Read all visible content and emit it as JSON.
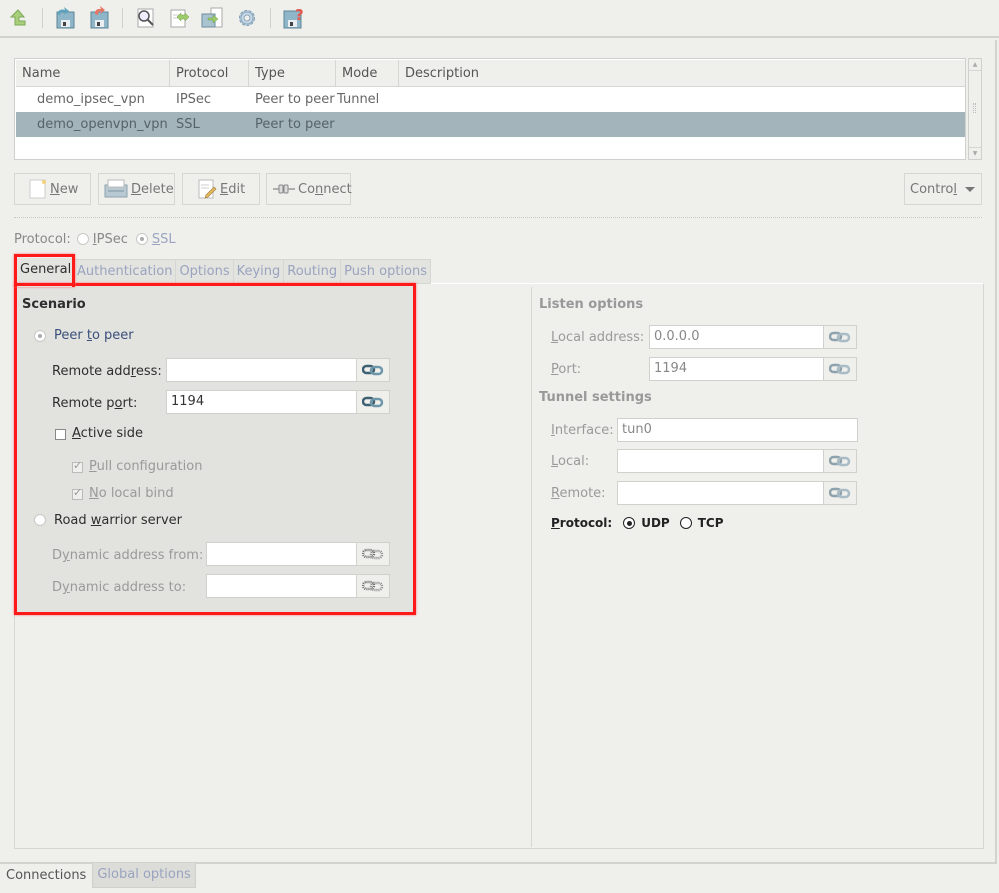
{
  "toolbar": {
    "buttons": [
      {
        "name": "go-up",
        "icon": "arrow-up-icon"
      },
      {
        "name": "save-and-apply",
        "icon": "save-undo-blue-icon"
      },
      {
        "name": "revert",
        "icon": "save-undo-red-icon"
      },
      {
        "name": "search",
        "icon": "magnifier-icon"
      },
      {
        "name": "import-export",
        "icon": "document-arrows-icon"
      },
      {
        "name": "transfer",
        "icon": "transfer-icon"
      },
      {
        "name": "settings",
        "icon": "gear-icon"
      },
      {
        "name": "save-help",
        "icon": "save-question-icon"
      }
    ]
  },
  "connections_table": {
    "columns": [
      "Name",
      "Protocol",
      "Type",
      "Mode",
      "Description"
    ],
    "rows": [
      {
        "name": "demo_ipsec_vpn",
        "protocol": "IPSec",
        "type": "Peer to peer",
        "mode": "Tunnel",
        "description": "",
        "selected": false
      },
      {
        "name": "demo_openvpn_vpn",
        "protocol": "SSL",
        "type": "Peer to peer",
        "mode": "",
        "description": "",
        "selected": true
      }
    ]
  },
  "actions": {
    "new": {
      "pre": "",
      "u": "N",
      "post": "ew"
    },
    "delete": {
      "pre": "",
      "u": "D",
      "post": "elete"
    },
    "edit": {
      "pre": "",
      "u": "E",
      "post": "dit"
    },
    "connect": {
      "pre": "Co",
      "u": "n",
      "post": "nect"
    },
    "control": {
      "pre": "Contro",
      "u": "l",
      "post": ""
    }
  },
  "protocol": {
    "label": "Protocol:",
    "options": [
      {
        "u": "I",
        "post": "PSec",
        "selected": false
      },
      {
        "u": "S",
        "post": "SL",
        "selected": true
      }
    ]
  },
  "tabs": [
    "General",
    "Authentication",
    "Options",
    "Keying",
    "Routing",
    "Push options"
  ],
  "active_tab": "General",
  "general": {
    "scenario_title": "Scenario",
    "peer_to_peer": {
      "pre": "Peer ",
      "u": "t",
      "post": "o peer",
      "selected": true
    },
    "remote_address": {
      "pre": "Remote add",
      "u": "r",
      "post": "ess:",
      "value": ""
    },
    "remote_port": {
      "pre": "Remote p",
      "u": "o",
      "post": "rt:",
      "value": "1194"
    },
    "active_side": {
      "pre": "",
      "u": "A",
      "post": "ctive side",
      "checked": false
    },
    "pull_configuration": {
      "pre": "",
      "u": "P",
      "post": "ull configuration",
      "checked": true,
      "disabled": true
    },
    "no_local_bind": {
      "pre": "",
      "u": "N",
      "post": "o local bind",
      "checked": true,
      "disabled": true
    },
    "road_warrior": {
      "pre": "Road ",
      "u": "w",
      "post": "arrior server",
      "selected": false
    },
    "dynamic_from": {
      "pre": "D",
      "u": "y",
      "post": "namic address from:",
      "value": ""
    },
    "dynamic_to": {
      "pre": "D",
      "u": "y",
      "post": "namic address to:",
      "value": ""
    }
  },
  "listen_options": {
    "title": "Listen options",
    "local_address": {
      "pre": "",
      "u": "L",
      "post": "ocal address:",
      "value": "0.0.0.0"
    },
    "port": {
      "pre": "",
      "u": "P",
      "post": "ort:",
      "value": "1194"
    }
  },
  "tunnel_settings": {
    "title": "Tunnel settings",
    "interface": {
      "pre": "",
      "u": "I",
      "post": "nterface:",
      "value": "tun0"
    },
    "local": {
      "pre": "",
      "u": "L",
      "post": "ocal:",
      "value": ""
    },
    "remote": {
      "pre": "",
      "u": "R",
      "post": "emote:",
      "value": ""
    },
    "protocol": {
      "u": "P",
      "post": "rotocol:",
      "options": [
        "UDP",
        "TCP"
      ],
      "selected": "UDP"
    }
  },
  "bottom_tabs": [
    "Connections",
    "Global options"
  ],
  "colors": {
    "selection": "#a3b4bb",
    "highlight_border": "#ff1a1a",
    "inactive_tab_text": "#9aa4bf"
  }
}
